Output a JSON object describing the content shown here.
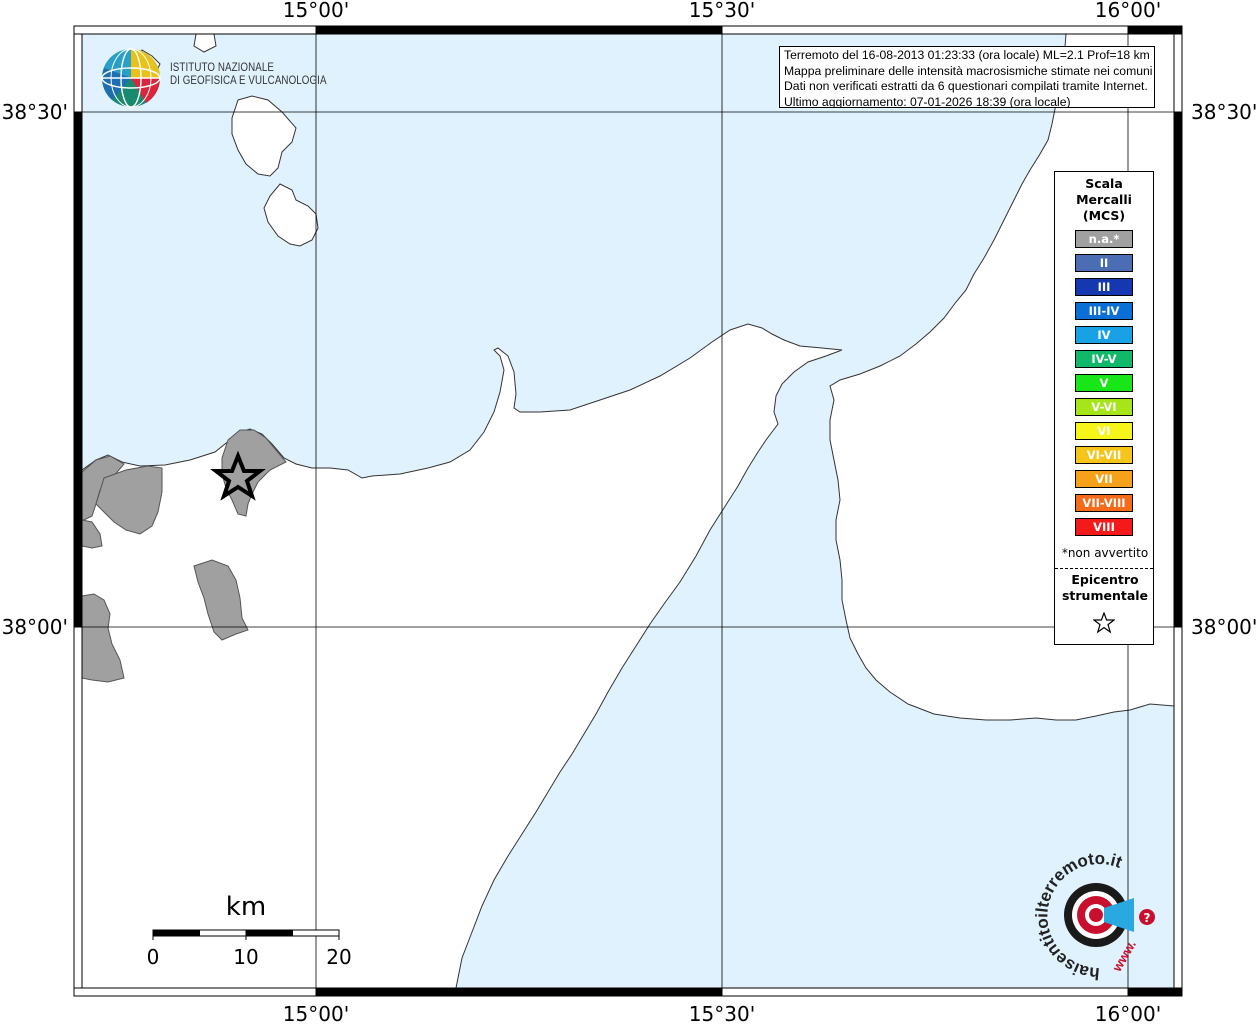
{
  "map": {
    "colors": {
      "sea": "#e0f2fd",
      "land": "#ffffff",
      "affected_area": "#a0a0a0",
      "frame": "#000000",
      "grid": "#000000"
    },
    "longitude_labels": [
      "15°00'",
      "15°30'",
      "16°00'"
    ],
    "latitude_labels": [
      "38°30'",
      "38°00'"
    ],
    "scale_bar": {
      "unit": "km",
      "ticks": [
        "0",
        "10",
        "20"
      ]
    },
    "epicenter": {
      "symbol": "star"
    }
  },
  "logo": {
    "line1": "ISTITUTO NAZIONALE",
    "line2": "DI GEOFISICA E VULCANOLOGIA",
    "icon": "globe-logo-icon"
  },
  "info": {
    "line1": "Terremoto del 16-08-2013 01:23:33 (ora locale) ML=2.1 Prof=18 km",
    "line2": "Mappa preliminare delle intensità macrosismiche stimate nei comuni",
    "line3": "Dati non verificati estratti da 6 questionari compilati tramite Internet.",
    "line4": "Ultimo aggiornamento: 07-01-2026 18:39 (ora locale)"
  },
  "legend": {
    "title_line1": "Scala",
    "title_line2": "Mercalli",
    "title_line3": "(MCS)",
    "items": [
      {
        "label": "n.a.*",
        "color": "#a0a0a0"
      },
      {
        "label": "II",
        "color": "#4b6db3"
      },
      {
        "label": "III",
        "color": "#1538b0"
      },
      {
        "label": "III-IV",
        "color": "#0b6fd6"
      },
      {
        "label": "IV",
        "color": "#19a1e6"
      },
      {
        "label": "IV-V",
        "color": "#12b86a"
      },
      {
        "label": "V",
        "color": "#19e619"
      },
      {
        "label": "V-VI",
        "color": "#a6e619"
      },
      {
        "label": "VI",
        "color": "#f5f51a"
      },
      {
        "label": "VI-VII",
        "color": "#f5c51a"
      },
      {
        "label": "VII",
        "color": "#f5a11a"
      },
      {
        "label": "VII-VIII",
        "color": "#f56b1a"
      },
      {
        "label": "VIII",
        "color": "#f51a1a"
      }
    ],
    "note": "*non avvertito",
    "epicenter_line1": "Epicentro",
    "epicenter_line2": "strumentale",
    "epicenter_icon": "star-outline-icon"
  },
  "watermark": {
    "text": "haisentitoilterremoto.it",
    "url_text": "www.",
    "icon": "target-megaphone-icon"
  }
}
